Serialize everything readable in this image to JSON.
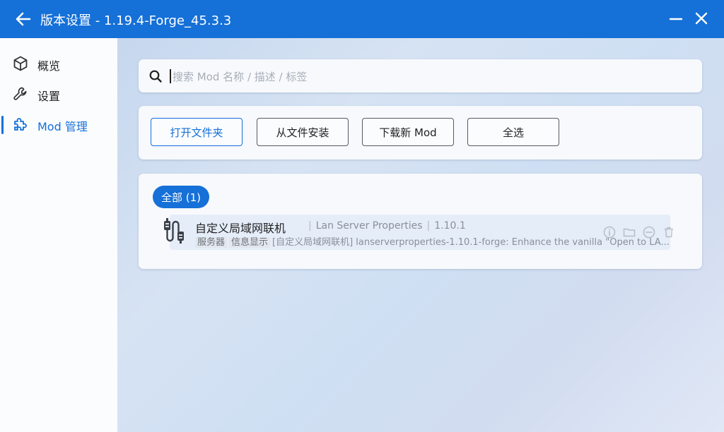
{
  "window": {
    "title": "版本设置 - 1.19.4-Forge_45.3.3"
  },
  "sidebar": {
    "items": [
      {
        "label": "概览",
        "icon": "cube-icon"
      },
      {
        "label": "设置",
        "icon": "wrench-icon"
      },
      {
        "label": "Mod 管理",
        "icon": "puzzle-icon",
        "active": true
      }
    ]
  },
  "search": {
    "placeholder": "搜索 Mod 名称 / 描述 / 标签",
    "value": ""
  },
  "toolbar": {
    "open_folder": "打开文件夹",
    "install_from_file": "从文件安装",
    "download_new": "下载新 Mod",
    "select_all": "全选"
  },
  "filter": {
    "all_label": "全部 (1)"
  },
  "mods": [
    {
      "name": "自定义局域网联机",
      "english_name": "Lan Server Properties",
      "version": "1.10.1",
      "tags": [
        "服务器",
        "信息显示"
      ],
      "description": "[自定义局域网联机] lanserverproperties-1.10.1-forge: Enhance the vanilla \"Open to LA..."
    }
  ],
  "colors": {
    "accent": "#1570d8",
    "titlebar": "#1570d8"
  }
}
